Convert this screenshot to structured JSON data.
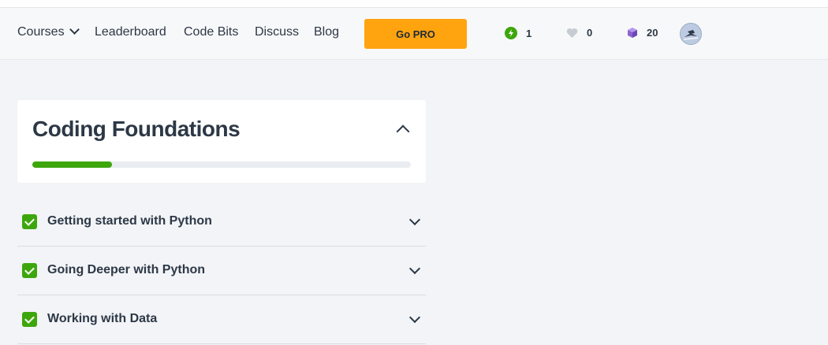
{
  "nav": {
    "courses_label": "Courses",
    "leaderboard_label": "Leaderboard",
    "codebits_label": "Code Bits",
    "discuss_label": "Discuss",
    "blog_label": "Blog",
    "pro_label": "Go PRO"
  },
  "stats": {
    "streak": "1",
    "hearts": "0",
    "bits": "20"
  },
  "course": {
    "title": "Coding Foundations",
    "progress_percent": 21
  },
  "lessons": [
    {
      "title": "Getting started with Python",
      "completed": true
    },
    {
      "title": "Going Deeper with Python",
      "completed": true
    },
    {
      "title": "Working with Data",
      "completed": true
    }
  ],
  "colors": {
    "accent": "#ffa40f",
    "success": "#3ea60d",
    "heart": "#c7ccd3",
    "bits": "#8a63d2"
  },
  "icons": [
    "chevron-down-icon",
    "lightning-icon",
    "heart-icon",
    "cube-icon",
    "chevron-up-icon",
    "checkbox-icon"
  ]
}
